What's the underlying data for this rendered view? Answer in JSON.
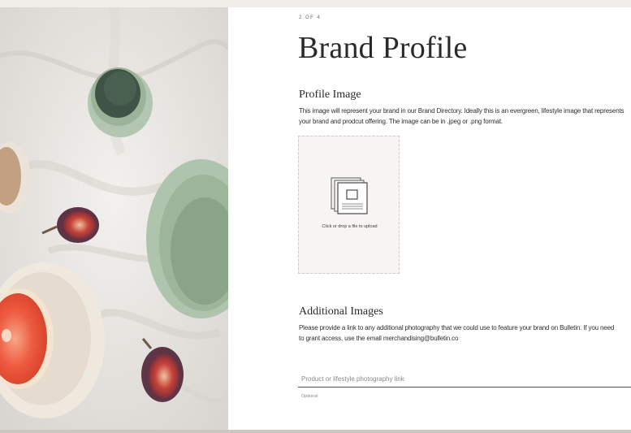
{
  "step_indicator": "2 OF 4",
  "page_title": "Brand Profile",
  "profile_image": {
    "heading": "Profile Image",
    "description": "This image will represent your brand in our Brand Directory. Ideally this is an evergreen, lifestyle image that represents your brand and prodcut offering. The image can be in .jpeg or .png format.",
    "dropzone_label": "Click or drop a file to upload",
    "icon": "image-stack-icon"
  },
  "additional_images": {
    "heading": "Additional Images",
    "description": "Please provide a link to any additional photography that we could use to feature your brand on Bulletin. If you need to grant access, use the email merchandising@bulletin.co",
    "input_placeholder": "Product or lifestyle photography link",
    "input_value": "",
    "hint": "Optional"
  },
  "colors": {
    "page_bg": "#f1ede8",
    "panel_bg": "#ffffff",
    "dropzone_bg": "#f7f5f2",
    "text": "#2a2a2a",
    "sage_ceramic": "#a9bfa8",
    "grapefruit": "#e8533a"
  }
}
